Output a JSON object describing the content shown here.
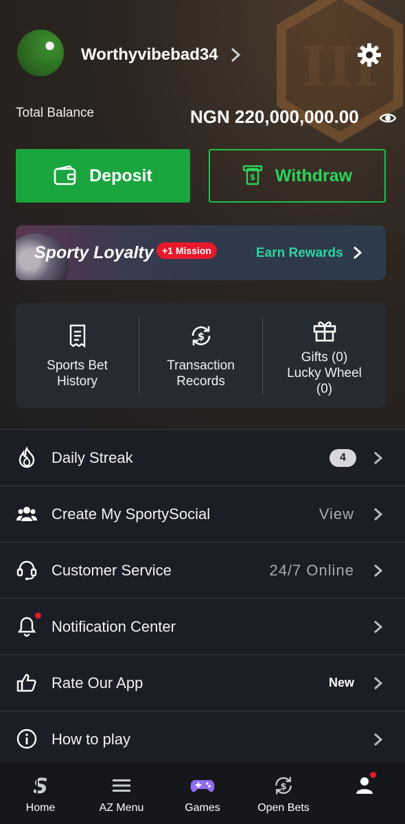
{
  "profile": {
    "username": "Worthyvibebad34",
    "balance_label": "Total Balance",
    "balance_value": "NGN 220,000,000.00"
  },
  "actions": {
    "deposit_label": "Deposit",
    "withdraw_label": "Withdraw"
  },
  "loyalty": {
    "title": "Sporty Loyalty",
    "mission_badge": "+1 Mission",
    "cta": "Earn Rewards"
  },
  "quick_links": [
    {
      "line1": "Sports Bet",
      "line2": "History",
      "icon": "receipt-icon"
    },
    {
      "line1": "Transaction",
      "line2": "Records",
      "icon": "currency-refresh-icon"
    },
    {
      "line1": "Gifts (0)",
      "line2": "Lucky Wheel",
      "line3": "(0)",
      "icon": "gift-icon"
    }
  ],
  "menu": [
    {
      "label": "Daily Streak",
      "badge": "4",
      "icon": "flame-icon"
    },
    {
      "label": "Create My SportySocial",
      "right": "View",
      "icon": "group-icon"
    },
    {
      "label": "Customer Service",
      "right": "24/7 Online",
      "icon": "headset-icon"
    },
    {
      "label": "Notification Center",
      "icon": "bell-icon"
    },
    {
      "label": "Rate Our App",
      "right": "New",
      "icon": "thumbs-up-icon"
    },
    {
      "label": "How to play",
      "icon": "info-icon"
    }
  ],
  "nav": [
    {
      "label": "Home",
      "icon": "sporty-logo-icon"
    },
    {
      "label": "AZ Menu",
      "icon": "hamburger-icon"
    },
    {
      "label": "Games",
      "icon": "gamepad-icon"
    },
    {
      "label": "Open Bets",
      "icon": "currency-refresh-icon"
    },
    {
      "label": "",
      "icon": "user-icon"
    }
  ],
  "colors": {
    "accent_green": "#1aa53f",
    "teal": "#2dd4a0",
    "alert_red": "#e8192c",
    "games_purple": "#8f6bf0"
  }
}
